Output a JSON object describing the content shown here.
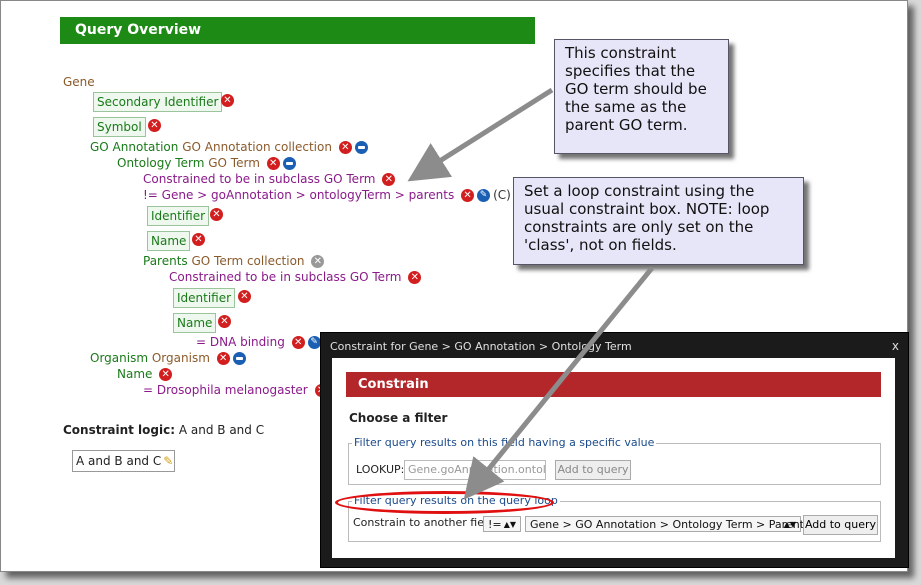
{
  "query_overview": {
    "title": "Query Overview",
    "root": "Gene",
    "secondary_identifier": "Secondary Identifier",
    "symbol": "Symbol",
    "go_annotation_field": "GO Annotation",
    "go_annotation_type": "GO Annotation  collection",
    "ontology_term_field": "Ontology Term",
    "ontology_term_type": "GO Term",
    "subclass_constraint_1": "Constrained to be in subclass  GO Term",
    "loop_constraint": "!= Gene > goAnnotation > ontologyTerm > parents",
    "loop_constraint_code": "(C)",
    "identifier_1": "Identifier",
    "name_1": "Name",
    "parents_field": "Parents",
    "parents_type": "GO Term  collection",
    "subclass_constraint_2": "Constrained to be in subclass  GO Term",
    "identifier_2": "Identifier",
    "name_2": "Name",
    "name_value": "= DNA binding",
    "organism_field": "Organism",
    "organism_type": "Organism",
    "organism_name": "Name",
    "organism_value": "= Drosophila melanogaster",
    "logic_label": "Constraint logic:",
    "logic_value": "A and B and C",
    "logic_box": "A and B and C"
  },
  "notes": {
    "note1": "This constraint specifies that the GO term should be the same as the parent GO term.",
    "note2": "Set a loop constraint using the usual constraint box. NOTE: loop constraints are only set on the 'class', not on fields."
  },
  "dialog": {
    "title": "Constraint for Gene > GO Annotation > Ontology Term",
    "close": "x",
    "header": "Constrain",
    "choose_filter": "Choose a filter",
    "fieldset1_legend": "Filter query results on this field having a specific value",
    "lookup_label": "LOOKUP:",
    "lookup_placeholder": "Gene.goAnnotation.ontologyTerm",
    "add_button_1": "Add to query",
    "fieldset2_legend": "Filter query results on the query loop",
    "constrain_label": "Constrain to another field:",
    "operator": "!=",
    "path_option": "Gene > GO Annotation > Ontology Term > Parents",
    "add_button_2": "Add to query"
  },
  "colors": {
    "header_green": "#1e8a16",
    "constrain_red": "#b3262a",
    "highlight_oval": "#e01010"
  }
}
